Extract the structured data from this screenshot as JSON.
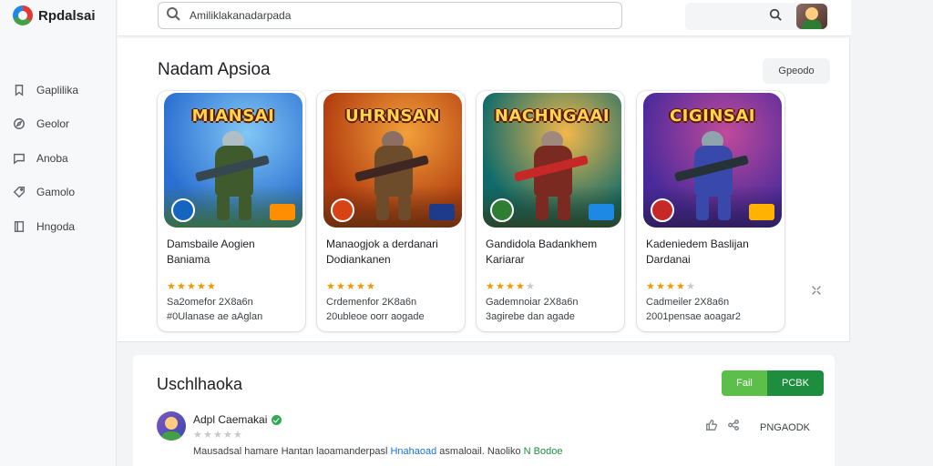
{
  "app": {
    "name": "Rpdalsai",
    "icon": "app-logo-icon"
  },
  "search": {
    "value": "Amiliklakanadarpada",
    "icon": "search-icon"
  },
  "sidebar": {
    "items": [
      {
        "label": "Gaplilika",
        "icon": "bookmark-icon"
      },
      {
        "label": "Geolor",
        "icon": "compass-icon"
      },
      {
        "label": "Anoba",
        "icon": "chat-icon"
      },
      {
        "label": "Gamolo",
        "icon": "tag-icon"
      },
      {
        "label": "Hngoda",
        "icon": "book-icon"
      }
    ]
  },
  "featured": {
    "title": "Nadam Apsioa",
    "more_label": "Gpeodo",
    "cards": [
      {
        "banner": "MIANSAI",
        "title_line1": "Damsbaile Aogien",
        "title_line2": "Baniama",
        "rating": 5,
        "meta1": "Sa2omefor 2X8a6n",
        "meta2": "#0Ulanase ae aAglan",
        "palette": {
          "sky": "#2a6fd1",
          "sky2": "#82c7f5",
          "ground": "#3d6b2a",
          "body": "#3f5a2c",
          "head": "#b0bec5",
          "gun": "#37474f",
          "badgeL": "#1565c0",
          "badgeR": "#ff8f00"
        }
      },
      {
        "banner": "UHRNSAN",
        "title_line1": "Manaogjok a derdanari",
        "title_line2": "Dodiankanen",
        "rating": 5,
        "meta1": "Crdemenfor 2K8a6n",
        "meta2": "20ubleoe oorr aogade",
        "palette": {
          "sky": "#b23c0f",
          "sky2": "#f2a03a",
          "ground": "#5d2e10",
          "body": "#6d4c2b",
          "head": "#8d6e63",
          "gun": "#3e2723",
          "badgeL": "#d84315",
          "badgeR": "#1e3a8a"
        }
      },
      {
        "banner": "NACHNGAAI",
        "title_line1": "Gandidola Badankhem",
        "title_line2": "Kariarar",
        "rating": 4,
        "meta1": "Gademnoiar 2X8a6n",
        "meta2": "3agirebe dan agade",
        "palette": {
          "sky": "#0f6b6b",
          "sky2": "#f2b84b",
          "ground": "#2e3d1f",
          "body": "#7a2a20",
          "head": "#a1887f",
          "gun": "#c62828",
          "badgeL": "#2e7d32",
          "badgeR": "#1e88e5"
        }
      },
      {
        "banner": "CIGINSAI",
        "title_line1": "Kadeniedem Baslijan",
        "title_line2": "Dardanai",
        "rating": 4,
        "meta1": "Cadmeiler 2X8a6n",
        "meta2": "2001pensae aoagar2",
        "palette": {
          "sky": "#4a2a9b",
          "sky2": "#c04a9b",
          "ground": "#2b1c52",
          "body": "#3949ab",
          "head": "#90a4ae",
          "gun": "#263238",
          "badgeL": "#c62828",
          "badgeR": "#ffb300"
        }
      }
    ]
  },
  "reviews": {
    "title": "Uschlhaoka",
    "btn_a": "Fail",
    "btn_b": "PCBK",
    "action_label": "PNGAODK",
    "review": {
      "name": "Adpl Caemakai",
      "rating": 0,
      "text_part1": "Mausadsal hamare Hantan laoamanderpasl ",
      "text_hl1": "Hnahaoad",
      "text_part2": " asmaloail. Naoliko ",
      "text_hl2": "N Bodoe"
    }
  }
}
